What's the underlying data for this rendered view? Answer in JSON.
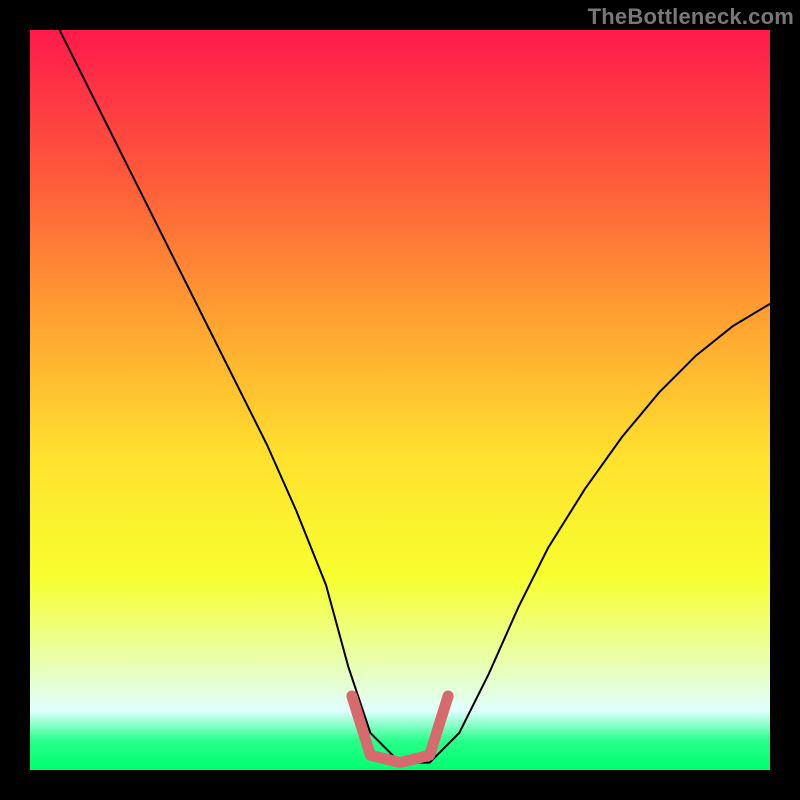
{
  "watermark": "TheBottleneck.com",
  "chart_data": {
    "type": "line",
    "title": "",
    "xlabel": "",
    "ylabel": "",
    "xlim": [
      0,
      100
    ],
    "ylim": [
      0,
      100
    ],
    "gradient_stops": [
      {
        "offset": 0.0,
        "color": "#ff1a4b"
      },
      {
        "offset": 0.2,
        "color": "#ff5a3a"
      },
      {
        "offset": 0.4,
        "color": "#ffa531"
      },
      {
        "offset": 0.58,
        "color": "#ffe22e"
      },
      {
        "offset": 0.74,
        "color": "#f7ff2e"
      },
      {
        "offset": 0.86,
        "color": "#e8ffb5"
      },
      {
        "offset": 0.92,
        "color": "#e0ffff"
      },
      {
        "offset": 0.96,
        "color": "#29ff8a"
      },
      {
        "offset": 1.0,
        "color": "#00ff72"
      }
    ],
    "series": [
      {
        "name": "bottleneck-curve",
        "color": "#000000",
        "width": 2,
        "x": [
          4,
          8,
          12,
          16,
          20,
          24,
          28,
          32,
          36,
          40,
          43,
          46,
          50,
          54,
          58,
          62,
          66,
          70,
          75,
          80,
          85,
          90,
          95,
          100
        ],
        "y": [
          100,
          92,
          84,
          76,
          68,
          60,
          52,
          44,
          35,
          25,
          14,
          5,
          1,
          1,
          5,
          13,
          22,
          30,
          38,
          45,
          51,
          56,
          60,
          63
        ]
      },
      {
        "name": "highlight-segment",
        "color": "#d66a6d",
        "width": 11,
        "linecap": "round",
        "x": [
          43.5,
          46,
          50,
          54,
          56.5
        ],
        "y": [
          10,
          2,
          1,
          2,
          10
        ]
      }
    ]
  }
}
